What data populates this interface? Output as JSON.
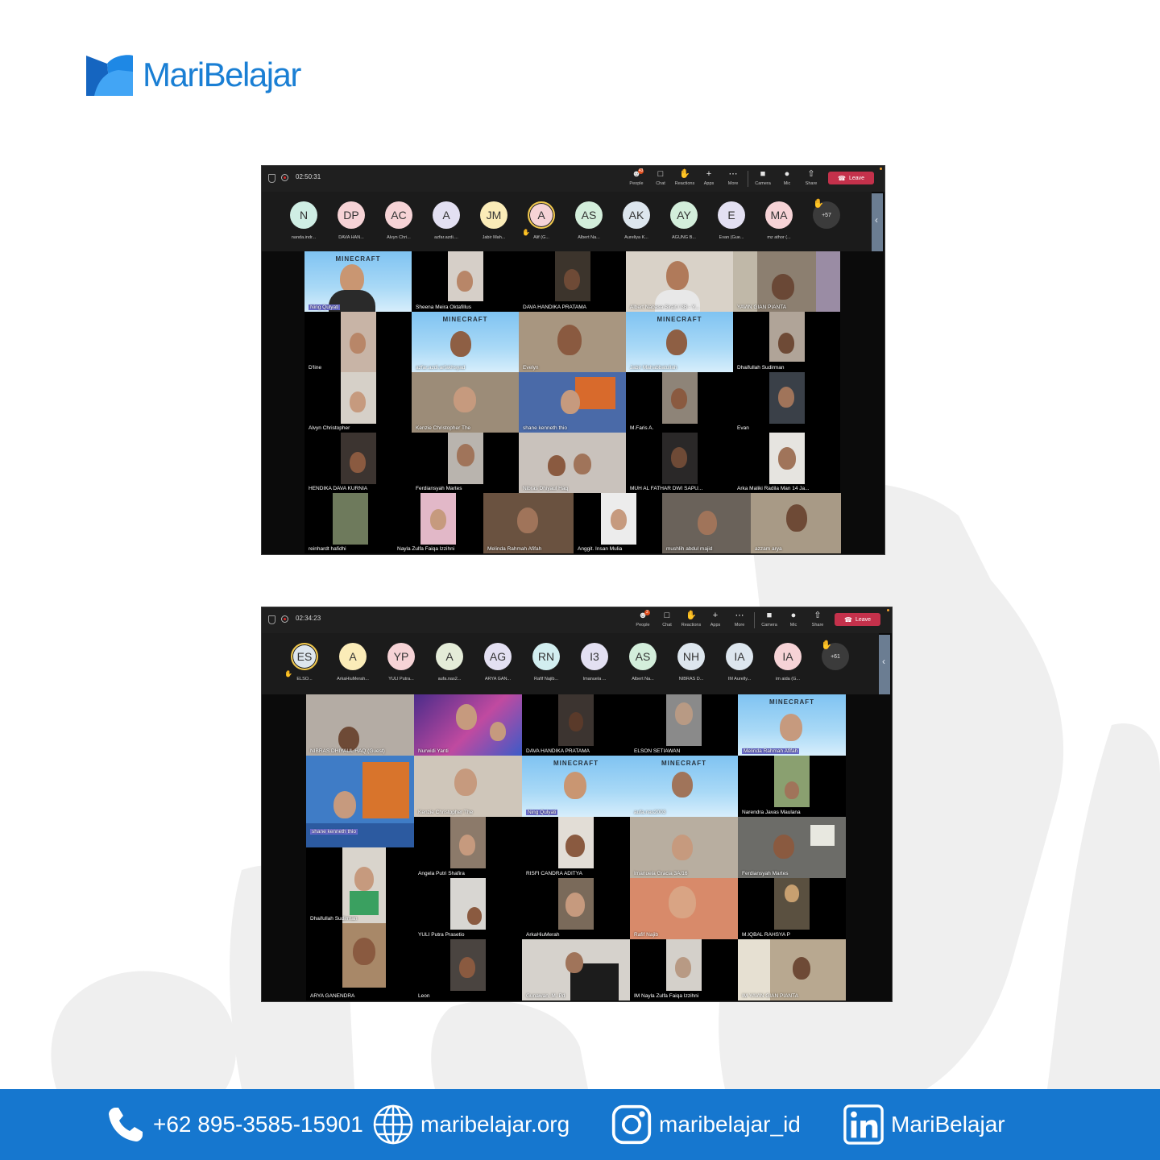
{
  "brand": {
    "name": "MariBelajar",
    "color": "#1a7fd4"
  },
  "meeting1": {
    "timer": "02:50:31",
    "toolbar": {
      "people": "People",
      "people_badge": "43",
      "chat": "Chat",
      "reactions": "Reactions",
      "apps": "Apps",
      "more": "More",
      "camera": "Camera",
      "mic": "Mic",
      "share": "Share",
      "leave": "Leave"
    },
    "participants": [
      {
        "initials": "N",
        "name": "nanda.indr..."
      },
      {
        "initials": "DP",
        "name": "DAVA HAN..."
      },
      {
        "initials": "AC",
        "name": "Alvyn Chri..."
      },
      {
        "initials": "A",
        "name": "azfar.azdi...."
      },
      {
        "initials": "JM",
        "name": "Jabir Mah..."
      },
      {
        "initials": "A",
        "name": "Alif (G..."
      },
      {
        "initials": "AS",
        "name": "Albert Na..."
      },
      {
        "initials": "AK",
        "name": "Aureliya K..."
      },
      {
        "initials": "AY",
        "name": "AGUNG B..."
      },
      {
        "initials": "E",
        "name": "Evan (Gue..."
      },
      {
        "initials": "MA",
        "name": "mz athor (..."
      }
    ],
    "more_count": "+57",
    "tiles": [
      "Ning Qulyati",
      "Sheena Meira Oktafillus",
      "DAVA HANDIKA PRATAMA",
      "Albert Nabasa Sirait / 3B - Y...",
      "YAVIN GIAN PIANTA",
      "D'line",
      "azfar.azdi.arfakhsyad",
      "Evelyn",
      "Jabir Mahabbatullah",
      "Dhaifullah Sudirman",
      "Alvyn Christopher",
      "Kenzie Christopher The",
      "shane kenneth thio",
      "M.Faris A.",
      "Evan",
      "HENDIKA DAVA KURNIA",
      "Ferdiansyah Martes",
      "Nibras Dhiyaul Haq",
      "MUH  AL FATHAR DWI SAPU...",
      "Arka Maliki Radila Man 14 Ja...",
      "reinhardt hafidhi",
      "Nayla Zulfa Faiqa Izzihni",
      "Melinda Rahmah Afifah",
      "Anggit. Insan Mulia",
      "mushlih abdul majid",
      "azzam arya"
    ],
    "minecraft_banner": "MINECRAFT"
  },
  "meeting2": {
    "timer": "02:34:23",
    "toolbar": {
      "people": "People",
      "people_badge": "2",
      "chat": "Chat",
      "reactions": "Reactions",
      "apps": "Apps",
      "more": "More",
      "camera": "Camera",
      "mic": "Mic",
      "share": "Share",
      "leave": "Leave"
    },
    "participants": [
      {
        "initials": "ES",
        "name": "ELSO..."
      },
      {
        "initials": "A",
        "name": "ArkaHiuMerah..."
      },
      {
        "initials": "YP",
        "name": "YULI Putra..."
      },
      {
        "initials": "A",
        "name": "aufa.nas2..."
      },
      {
        "initials": "AG",
        "name": "ARYA GAN..."
      },
      {
        "initials": "RN",
        "name": "Rafif Najib..."
      },
      {
        "initials": "I3",
        "name": "Imanuela ..."
      },
      {
        "initials": "AS",
        "name": "Albert Na..."
      },
      {
        "initials": "NH",
        "name": "NIBRAS D..."
      },
      {
        "initials": "IA",
        "name": "IM Aurelly..."
      },
      {
        "initials": "IA",
        "name": "im aida (G..."
      }
    ],
    "more_count": "+61",
    "tiles": [
      "NIBRAS DHIYAUL HAQ (Guest)",
      "Nurwidi Yanti",
      "DAVA HANDIKA PRATAMA",
      "ELSON SETIAWAN",
      "Melinda Rahmah Afifah",
      "Kenzie Christopher The",
      "Ning Qulyati",
      "aufa.nas2003",
      "Narendra Javas Maulana",
      "shane kenneth thio",
      "Angela Putri Shafira",
      "RISFI CANDRA ADITYA",
      "Imanuela Gracia 3A/16",
      "Ferdiansyah Martes",
      "Dhaifullah Sudirman",
      "YULI Putra Prasetio",
      "ArkaHiuMerah",
      "Rafif Najib",
      "M.IQBAL RAHSYA P",
      "ARYA GANENDRA",
      "Leon",
      "Gunawan, M. Pd",
      "IM Nayla Zulfa Faiqa Izzihni",
      "IM YAVIN GIAN PIANTA"
    ],
    "minecraft_banner": "MINECRAFT"
  },
  "footer": {
    "phone": "+62 895-3585-15901",
    "website": "maribelajar.org",
    "instagram": "maribelajar_id",
    "linkedin": "MariBelajar"
  }
}
